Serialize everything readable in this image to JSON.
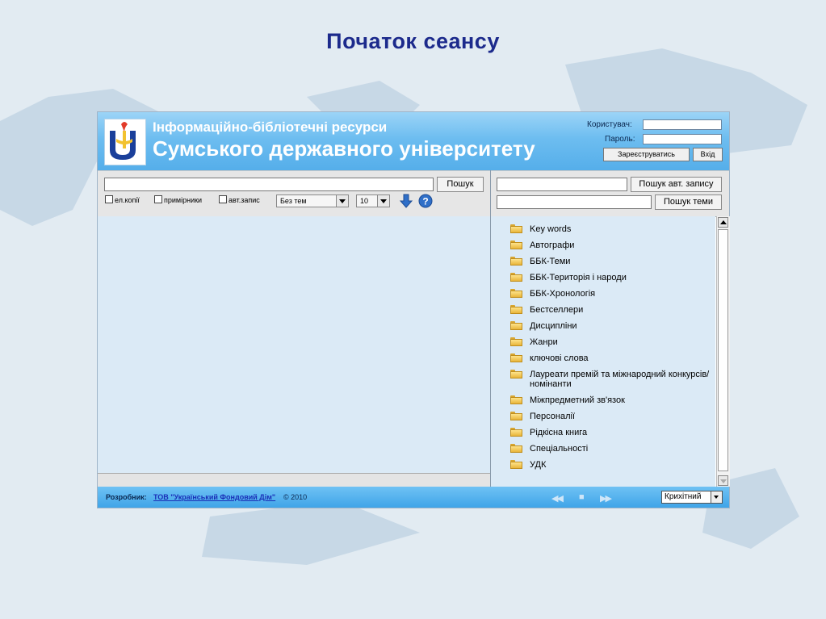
{
  "slide_title": "Початок сеансу",
  "header": {
    "line1": "Інформаційно-бібліотечні ресурси",
    "line2": "Сумського державного університету",
    "user_label": "Користувач:",
    "password_label": "Пароль:",
    "register_label": "Зареєструватись",
    "login_label": "Вхід"
  },
  "search": {
    "left_query": "",
    "search_label": "Пошук",
    "option1": "ел.копії",
    "option2": "примірники",
    "option3": "авт.запис",
    "theme_select": "Без тем",
    "count_select": "10",
    "author_query": "",
    "author_search_label": "Пошук авт. запису",
    "theme_query": "",
    "theme_search_label": "Пошук теми"
  },
  "tree": {
    "items": [
      "Key words",
      "Автографи",
      "ББК-Теми",
      "ББК-Територія і народи",
      "ББК-Хронологія",
      "Бестселлери",
      "Дисципліни",
      "Жанри",
      "ключові слова",
      "Лауреати премій та міжнародний конкурсів/номінанти",
      "Міжпредметний зв'язок",
      "Персоналії",
      "Рідкісна книга",
      "Спеціальності",
      "УДК"
    ]
  },
  "footer": {
    "developer_label": "Розробник:",
    "developer_link": "ТОВ \"Український Фондовий Дім\"",
    "copyright": "© 2010",
    "skin_select": "Крихітний"
  },
  "colors": {
    "title": "#1c2a8c",
    "header_blue": "#55aeea",
    "pane_bg": "#dbeaf6"
  }
}
